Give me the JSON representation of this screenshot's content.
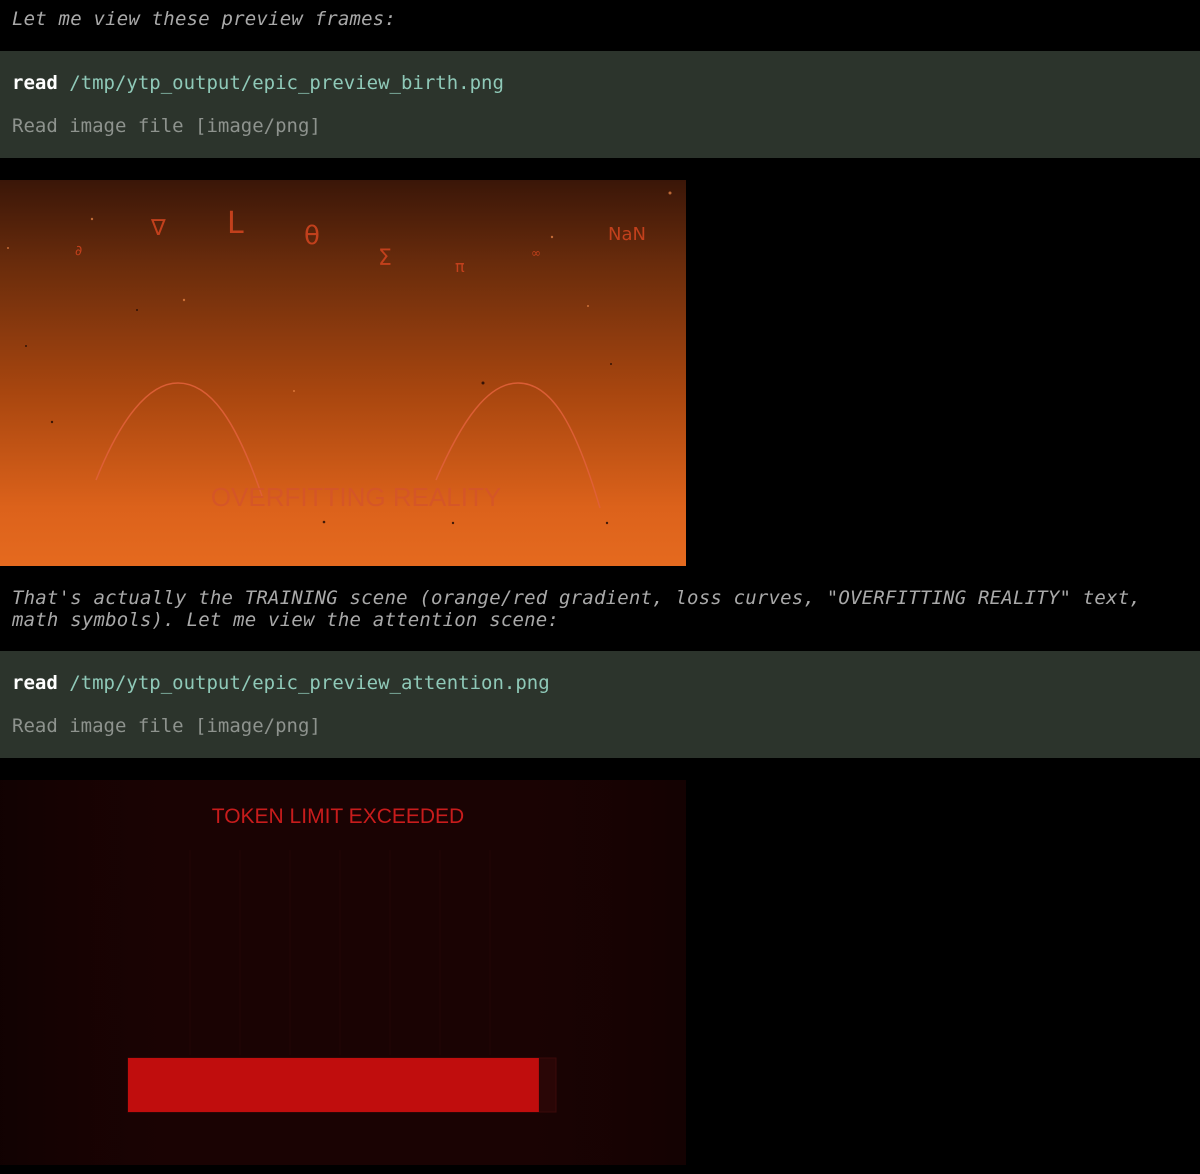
{
  "messages": {
    "narration_1": "Let me view these preview frames:",
    "narration_2": "That's actually the TRAINING scene (orange/red gradient, loss curves, \"OVERFITTING REALITY\" text, math symbols). Let me view the attention scene:"
  },
  "tool_calls": [
    {
      "command": "read",
      "path": "/tmp/ytp_output/epic_preview_birth.png",
      "result": "Read image file [image/png]"
    },
    {
      "command": "read",
      "path": "/tmp/ytp_output/epic_preview_attention.png",
      "result": "Read image file [image/png]"
    }
  ],
  "preview_birth": {
    "symbols": [
      "∂",
      "∇",
      "L",
      "θ",
      "Σ",
      "π",
      "∞",
      "NaN"
    ],
    "caption": "OVERFITTING REALITY",
    "colors": {
      "gradient_top": "#3a1608",
      "gradient_bottom": "#e56a1f",
      "symbol": "#c2401c",
      "curve": "#e0603a",
      "caption": "#d4532c"
    }
  },
  "preview_attention": {
    "title": "TOKEN LIMIT EXCEEDED",
    "progress_fraction": 0.96,
    "colors": {
      "background": "#1a0303",
      "title": "#c81c1c",
      "bar_fill": "#c00d0d",
      "bar_track": "#2a0606"
    }
  },
  "colors": {
    "page_background": "#000000",
    "tool_block_background": "#2c342c",
    "narration_text": "#a9a9a9",
    "command_text": "#ffffff",
    "path_text": "#8fc9b8",
    "result_text": "#8e938e"
  }
}
